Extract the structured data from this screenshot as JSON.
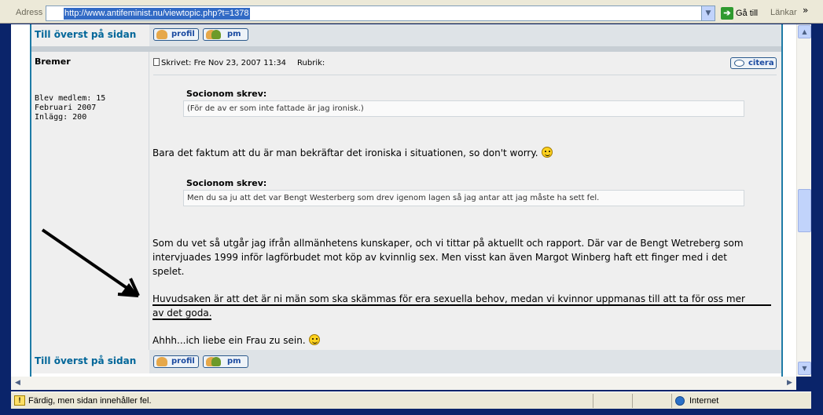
{
  "browser": {
    "address_label": "Adress",
    "url": "http://www.antifeminist.nu/viewtopic.php?t=1378",
    "go_label": "Gå till",
    "links_label": "Länkar",
    "chevron": "»"
  },
  "top_row": {
    "top_link": "Till överst på sidan",
    "profile_label": "profil",
    "pm_label": "pm"
  },
  "post": {
    "author": "Bremer",
    "member_since_line1": "Blev medlem: 15",
    "member_since_line2": "Februari 2007",
    "posts_count": "Inlägg: 200",
    "header_written": "Skrivet: Fre Nov 23, 2007 11:34",
    "header_subject": "Rubrik:",
    "quote_button": "citera",
    "quote1_author": "Socionom skrev:",
    "quote1_text": "(För de av er som inte fattade är jag ironisk.)",
    "paragraph1": "Bara det faktum att du är man bekräftar det ironiska i situationen, so don't worry.",
    "quote2_author": "Socionom skrev:",
    "quote2_text": "Men du sa ju att det var Bengt Westerberg som drev igenom lagen så jag antar att jag måste ha sett fel.",
    "paragraph2_line1": "Som du vet så utgår jag ifrån allmänhetens kunskaper, och vi tittar på aktuellt och rapport. Där var de Bengt Wetreberg som",
    "paragraph2_line2": "intervjuades 1999 inför lagförbudet mot köp av kvinnlig sex. Men visst kan även Margot Winberg haft ett finger med i det",
    "paragraph2_line3": "spelet.",
    "paragraph3_line1": "Huvudsaken är att det är ni män som ska skämmas för era sexuella behov, medan vi kvinnor uppmanas till att ta för oss mer",
    "paragraph3_line2": "av det goda",
    "paragraph3_end": ".",
    "paragraph4": "Ahhh...ich liebe ein Frau zu sein."
  },
  "bottom_row": {
    "top_link": "Till överst på sidan",
    "profile_label": "profil",
    "pm_label": "pm"
  },
  "status": {
    "message": "Färdig, men sidan innehåller fel.",
    "zone": "Internet",
    "warning_glyph": "!"
  },
  "icons": {
    "scroll_up": "▲",
    "scroll_down": "▼",
    "scroll_left": "◀",
    "scroll_right": "▶",
    "dropdown": "▼",
    "go": "➔"
  }
}
